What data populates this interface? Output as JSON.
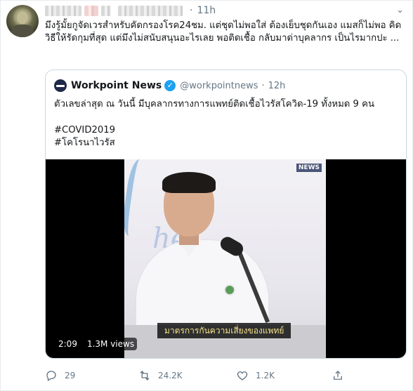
{
  "tweet": {
    "time": "11h",
    "separator": "·",
    "text": "มึงรู้มั้ยกูจัดเวรสำหรับคัดกรองโรค24ชม. แต่ชุดไม่พอใส่ ต้องเย็บชุดกันเอง แมสก็ไม่พอ คิดวิธีให้รัดกุมที่สุด แต่มึงไม่สนับสนุนอะไรเลย พอติดเชื้อ กลับมาด่าบุคลากร เป็นไรมากปะ ..."
  },
  "quote": {
    "name": "Workpoint News",
    "handle": "@workpointnews",
    "separator": "·",
    "time": "12h",
    "text": "ตัวเลขล่าสุด ณ วันนี้ มีบุคลากรทางการแพทย์ติดเชื้อไวรัสโควิด-19 ทั้งหมด 9 คน",
    "hashtags": [
      "#COVID2019",
      "#โคโรนาไวรัส"
    ],
    "video": {
      "duration": "2:09",
      "views": "1.3M views",
      "subtitle": "มาตรการกันความเสี่ยงของแพทย์",
      "watermark": "NEWS"
    }
  },
  "actions": {
    "reply_count": "29",
    "retweet_count": "24.2K",
    "like_count": "1.2K"
  },
  "icons": {
    "reply": "reply-icon",
    "retweet": "retweet-icon",
    "like": "heart-icon",
    "share": "share-icon",
    "verified": "verified-badge-icon",
    "menu": "chevron-down-icon"
  },
  "colors": {
    "accent": "#1da1f2",
    "muted": "#657786",
    "border": "#ccd6dd"
  }
}
